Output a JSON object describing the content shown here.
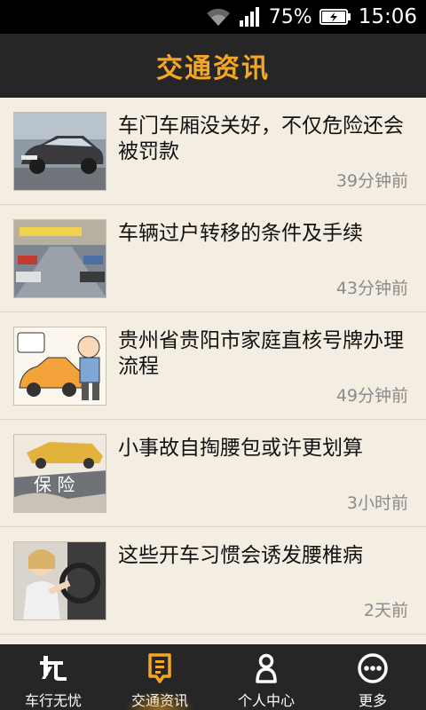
{
  "status_bar": {
    "battery_percent": "75%",
    "time": "15:06",
    "icons": [
      "wifi-icon",
      "signal-icon",
      "battery-icon"
    ]
  },
  "header": {
    "title": "交通资讯"
  },
  "news": [
    {
      "title": "车门车厢没关好，不仅危险还会被罚款",
      "time": "39分钟前",
      "thumb_icon": "car-photo"
    },
    {
      "title": "车辆过户转移的条件及手续",
      "time": "43分钟前",
      "thumb_icon": "car-lot-photo"
    },
    {
      "title": "贵州省贵阳市家庭直核号牌办理流程",
      "time": "49分钟前",
      "thumb_icon": "cartoon-car-photo"
    },
    {
      "title": "小事故自掏腰包或许更划算",
      "time": "3小时前",
      "thumb_icon": "insurance-photo"
    },
    {
      "title": "这些开车习惯会诱发腰椎病",
      "time": "2天前",
      "thumb_icon": "driver-photo"
    }
  ],
  "thumb_text": {
    "insurance": "保 险"
  },
  "tabs": [
    {
      "label": "车行无忧",
      "icon": "car-home-icon"
    },
    {
      "label": "交通资讯",
      "icon": "news-icon",
      "active": true
    },
    {
      "label": "个人中心",
      "icon": "person-icon"
    },
    {
      "label": "更多",
      "icon": "more-icon"
    }
  ],
  "colors": {
    "accent": "#f5a623",
    "bar_bg": "#262626",
    "list_bg": "#f4ede2"
  }
}
